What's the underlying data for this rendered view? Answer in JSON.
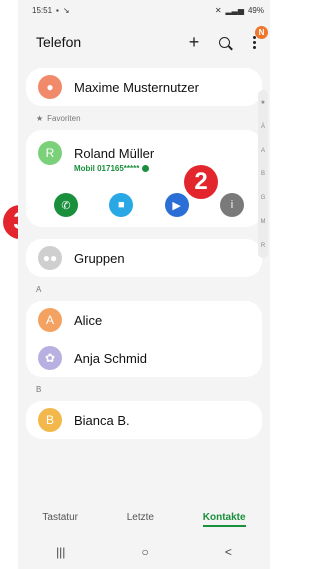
{
  "status_bar": {
    "time": "15:51",
    "battery": "49%"
  },
  "header": {
    "title": "Telefon",
    "add_label": "+",
    "notification_badge": "N"
  },
  "me": {
    "name": "Maxime Musternutzer",
    "initial": "",
    "avatar_color": "#f08a6a"
  },
  "favorites": {
    "label": "Favoriten",
    "star": "★",
    "contact": {
      "name": "Roland Müller",
      "initial": "R",
      "avatar_color": "#7ad17a",
      "sub": "Mobil 017165*****"
    }
  },
  "actions": [
    {
      "name": "call-button",
      "icon": "phone-icon",
      "glyph": "✆",
      "color": "#1a8f3c"
    },
    {
      "name": "message-button",
      "icon": "message-icon",
      "glyph": "■",
      "color": "#2aa8e6"
    },
    {
      "name": "video-button",
      "icon": "video-icon",
      "glyph": "▶",
      "color": "#2b6fd6"
    },
    {
      "name": "info-button",
      "icon": "info-icon",
      "glyph": "i",
      "color": "#7a7a7a"
    }
  ],
  "groups": {
    "label": "Gruppen",
    "avatar_color": "#cfcfcf"
  },
  "sections": [
    {
      "letter": "A",
      "contacts": [
        {
          "name": "Alice",
          "initial": "A",
          "avatar_color": "#f4a261"
        },
        {
          "name": "Anja Schmid",
          "initial": "",
          "avatar_color": "#b8b0e0"
        }
      ]
    },
    {
      "letter": "B",
      "contacts": [
        {
          "name": "Bianca B.",
          "initial": "B",
          "avatar_color": "#f2b84b"
        }
      ]
    }
  ],
  "alpha_index": [
    "★",
    "Ä",
    "A",
    "B",
    "G",
    "M",
    "R"
  ],
  "tabs": {
    "keypad": "Tastatur",
    "recent": "Letzte",
    "contacts": "Kontakte"
  },
  "nav": {
    "recents": "|||",
    "home": "○",
    "back": "<"
  },
  "callouts": {
    "two": "2",
    "three": "3",
    "color": "#e3262e"
  },
  "accent_color": "#1a8f3c"
}
